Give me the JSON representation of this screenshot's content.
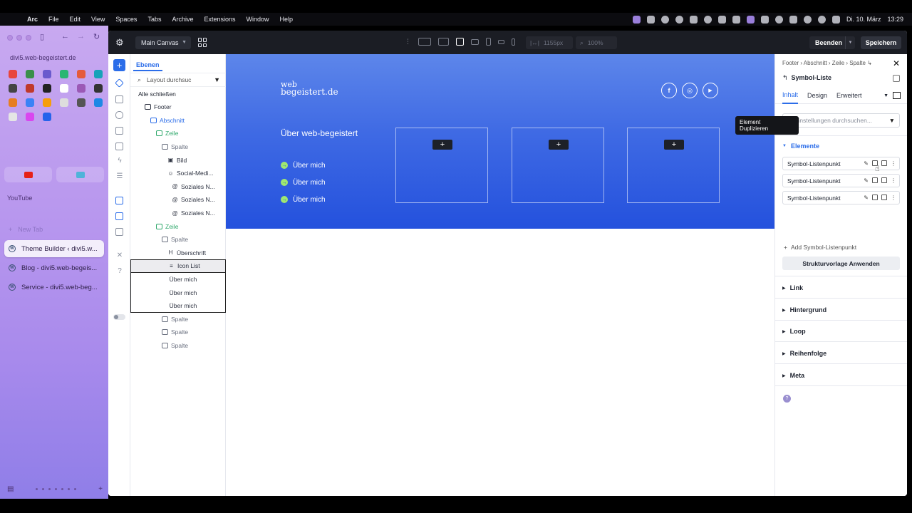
{
  "menubar": {
    "app": "Arc",
    "items": [
      "File",
      "Edit",
      "View",
      "Spaces",
      "Tabs",
      "Archive",
      "Extensions",
      "Window",
      "Help"
    ],
    "date": "Di. 10. März",
    "time": "13:29"
  },
  "arc": {
    "url": "divi5.web-begeistert.de",
    "pinned_label": "YouTube",
    "new_tab": "New Tab",
    "tabs": [
      {
        "label": "Theme Builder ‹ divi5.w..."
      },
      {
        "label": "Blog - divi5.web-begeis..."
      },
      {
        "label": "Service - divi5.web-beg..."
      }
    ],
    "favicon_colors": [
      "#e8453c",
      "#3a8f4a",
      "#6a5acd",
      "#2bb673",
      "#e55b3c",
      "#17a2b8",
      "#444",
      "#c0392b",
      "#222",
      "#fff",
      "#9b59b6",
      "#333",
      "#e67e22",
      "#3b82f6",
      "#f59e0b",
      "#ddd",
      "#555",
      "#1e88e5",
      "#e5e5e5",
      "#d946ef",
      "#2563eb"
    ]
  },
  "topbar": {
    "canvas": "Main Canvas",
    "width_value": "1155px",
    "zoom_value": "100%",
    "exit_label": "Beenden",
    "save_label": "Speichern"
  },
  "layers": {
    "tab": "Ebenen",
    "search_placeholder": "Layout durchsuc",
    "collapse_all": "Alle schließen",
    "tree": [
      {
        "label": "Footer",
        "indent": 0,
        "icon": "section"
      },
      {
        "label": "Abschnitt",
        "indent": 1,
        "icon": "section",
        "tone": "blue"
      },
      {
        "label": "Zeile",
        "indent": 2,
        "icon": "row",
        "tone": "green"
      },
      {
        "label": "Spalte",
        "indent": 3,
        "icon": "column",
        "tone": "muted"
      },
      {
        "label": "Bild",
        "indent": 4,
        "icon": "image"
      },
      {
        "label": "Social-Medi...",
        "indent": 4,
        "icon": "social"
      },
      {
        "label": "Soziales N...",
        "indent": 5,
        "icon": "at"
      },
      {
        "label": "Soziales N...",
        "indent": 5,
        "icon": "at"
      },
      {
        "label": "Soziales N...",
        "indent": 5,
        "icon": "at"
      },
      {
        "label": "Zeile",
        "indent": 2,
        "icon": "row",
        "tone": "green"
      },
      {
        "label": "Spalte",
        "indent": 3,
        "icon": "column",
        "tone": "muted"
      },
      {
        "label": "Überschrift",
        "indent": 4,
        "icon": "heading"
      },
      {
        "label": "Icon List",
        "indent": 4,
        "icon": "list",
        "selected": true
      },
      {
        "label": "Über mich",
        "indent": 5,
        "framed": true
      },
      {
        "label": "Über mich",
        "indent": 5,
        "framed": true
      },
      {
        "label": "Über mich",
        "indent": 5,
        "framed": true,
        "last": true
      },
      {
        "label": "Spalte",
        "indent": 3,
        "icon": "column",
        "tone": "muted"
      },
      {
        "label": "Spalte",
        "indent": 3,
        "icon": "column",
        "tone": "muted"
      },
      {
        "label": "Spalte",
        "indent": 3,
        "icon": "column",
        "tone": "muted"
      }
    ]
  },
  "canvas": {
    "logo_line1": "web",
    "logo_line2": "begeistert.de",
    "heading": "Über web-begeistert",
    "list_items": [
      "Über mich",
      "Über mich",
      "Über mich"
    ],
    "socials": [
      "f",
      "◎",
      "▶"
    ],
    "hero_color": "#2f5ce0"
  },
  "settings": {
    "breadcrumb": "Footer › Abschnitt › Zeile › Spalte ↳",
    "module": "Symbol-Liste",
    "tabs": [
      "Inhalt",
      "Design",
      "Erweitert"
    ],
    "search_placeholder": "Einstellungen durchsuchen...",
    "elements_group": "Elemente",
    "list_points": [
      "Symbol-Listenpunkt",
      "Symbol-Listenpunkt",
      "Symbol-Listenpunkt"
    ],
    "add_point": "Add Symbol-Listenpunkt",
    "apply_template": "Strukturvorlage Anwenden",
    "groups": [
      "Link",
      "Hintergrund",
      "Loop",
      "Reihenfolge",
      "Meta"
    ],
    "tooltip_line1": "Element",
    "tooltip_line2": "Duplizieren",
    "accent": "#2b6de9"
  }
}
